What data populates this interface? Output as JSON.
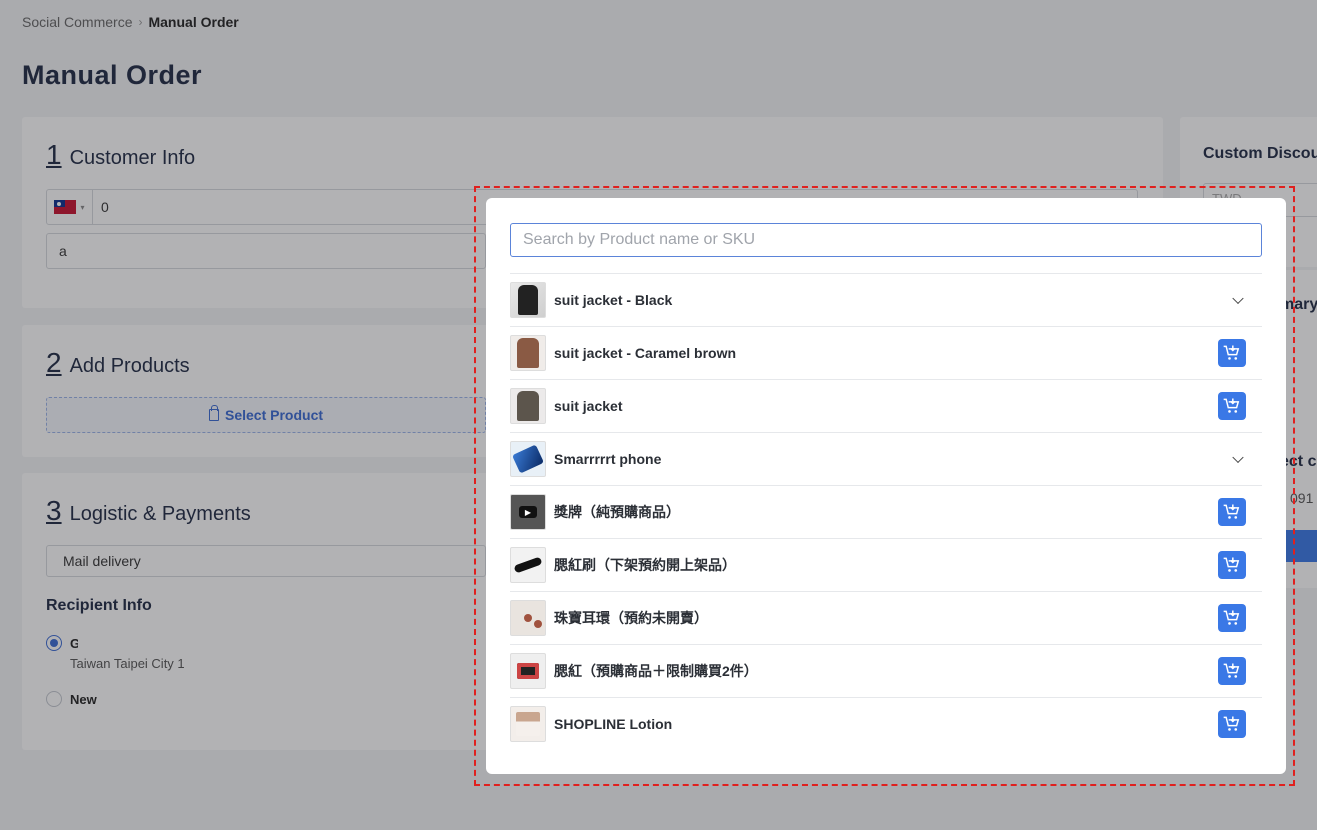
{
  "breadcrumb": {
    "parent": "Social Commerce",
    "current": "Manual Order"
  },
  "page_title": "Manual Order",
  "customer_section": {
    "number": "1",
    "title": "Customer Info",
    "phone_value": "0",
    "email_value": "a"
  },
  "products_section": {
    "number": "2",
    "title": "Add Products",
    "select_button": "Select Product"
  },
  "logistics_section": {
    "number": "3",
    "title": "Logistic & Payments",
    "delivery_value": "Mail delivery",
    "recipient_title": "Recipient Info",
    "recipient_name_initial": "G",
    "recipient_address": "Taiwan Taipei City 1",
    "new_option": "New"
  },
  "right_panel": {
    "discount_title": "Custom Discou",
    "currency_placeholder": "TWD",
    "summary_partial": "mary",
    "select_partial": "ect c",
    "number_partial": "091"
  },
  "modal": {
    "search_placeholder": "Search by Product name or SKU",
    "products": [
      {
        "name": "suit jacket - Black",
        "action": "expand",
        "thumb": "jacket-black"
      },
      {
        "name": "suit jacket - Caramel brown",
        "action": "add",
        "thumb": "jacket-brown"
      },
      {
        "name": "suit jacket",
        "action": "add",
        "thumb": "jacket-grey"
      },
      {
        "name": "Smarrrrrt phone",
        "action": "expand",
        "thumb": "phone"
      },
      {
        "name": "獎牌（純預購商品）",
        "action": "add",
        "thumb": "yt"
      },
      {
        "name": "腮紅刷（下架預約開上架品）",
        "action": "add",
        "thumb": "brush"
      },
      {
        "name": "珠寶耳環（預約未開賣）",
        "action": "add",
        "thumb": "earring"
      },
      {
        "name": "腮紅（預購商品＋限制購買2件）",
        "action": "add",
        "thumb": "blush"
      },
      {
        "name": "SHOPLINE Lotion",
        "action": "add",
        "thumb": "lotion"
      }
    ]
  },
  "colors": {
    "accent": "#3a78e6",
    "highlight": "#e0201e"
  }
}
